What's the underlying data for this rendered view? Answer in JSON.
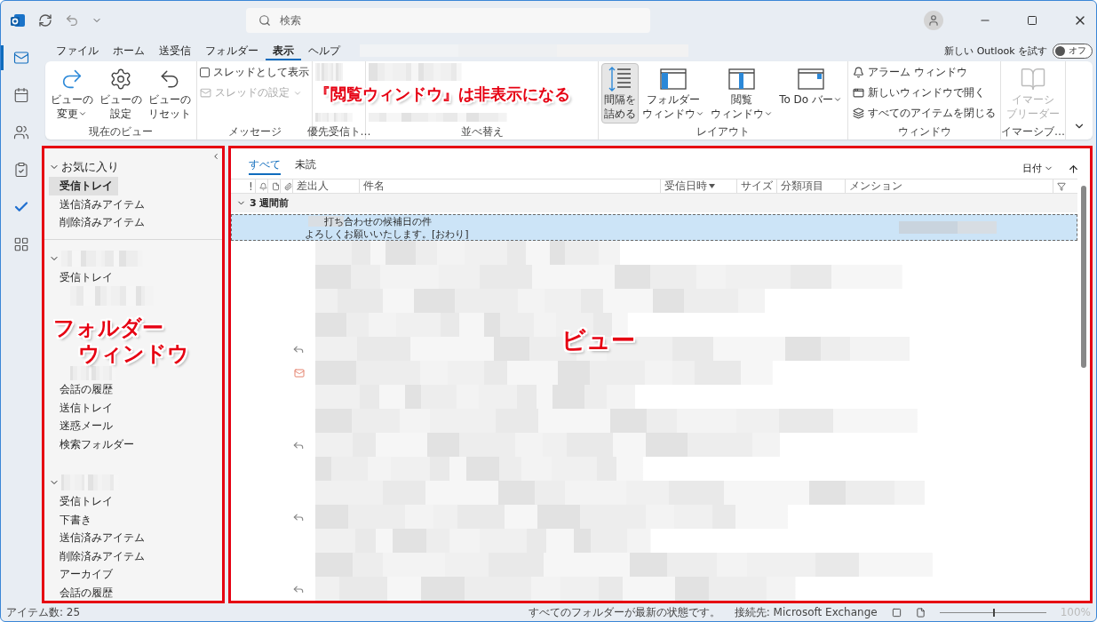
{
  "title_bar": {
    "search_placeholder": "検索"
  },
  "nav_rail": [
    {
      "kind": "mail",
      "selected": true
    },
    {
      "kind": "calendar",
      "selected": false
    },
    {
      "kind": "people",
      "selected": false
    },
    {
      "kind": "tasks",
      "selected": false
    },
    {
      "kind": "todo",
      "selected": false
    },
    {
      "kind": "apps",
      "selected": false
    }
  ],
  "menu_tabs": [
    {
      "label": "ファイル",
      "selected": false
    },
    {
      "label": "ホーム",
      "selected": false
    },
    {
      "label": "送受信",
      "selected": false
    },
    {
      "label": "フォルダー",
      "selected": false
    },
    {
      "label": "表示",
      "selected": true
    },
    {
      "label": "ヘルプ",
      "selected": false
    }
  ],
  "try_new_outlook": {
    "label": "新しい Outlook を試す",
    "toggle_label": "オフ",
    "on": false
  },
  "ribbon": {
    "callout": "『閲覧ウィンドウ』は非表示になる",
    "groups": [
      {
        "kind": "large",
        "label": "現在のビュー",
        "items": [
          {
            "kind": "change",
            "lines": [
              "ビューの",
              "変更"
            ],
            "caret": true,
            "selected": false,
            "disabled": false
          },
          {
            "kind": "settings",
            "lines": [
              "ビューの",
              "設定"
            ],
            "caret": false,
            "selected": false,
            "disabled": false
          },
          {
            "kind": "reset",
            "lines": [
              "ビューの",
              "リセット"
            ],
            "caret": false,
            "selected": false,
            "disabled": false
          }
        ]
      },
      {
        "kind": "message",
        "label": "メッセージ",
        "items": [
          {
            "kind": "checkbox",
            "label": "スレッドとして表示",
            "checked": false,
            "disabled": false
          },
          {
            "kind": "menu",
            "label": "スレッドの設定",
            "disabled": true
          }
        ]
      },
      {
        "kind": "redacted",
        "label": "優先受信ト…"
      },
      {
        "kind": "redacted",
        "label": "並べ替え"
      },
      {
        "kind": "large",
        "label": "レイアウト",
        "items": [
          {
            "kind": "spacing",
            "lines": [
              "間隔を",
              "詰める"
            ],
            "caret": false,
            "selected": true,
            "disabled": false
          },
          {
            "kind": "folder-pane",
            "lines": [
              "フォルダー",
              "ウィンドウ"
            ],
            "caret": true,
            "selected": false,
            "disabled": false
          },
          {
            "kind": "reading-pane",
            "lines": [
              "閲覧",
              "ウィンドウ"
            ],
            "caret": true,
            "selected": false,
            "disabled": false
          },
          {
            "kind": "todo-bar",
            "lines": [
              "To Do バー"
            ],
            "caret": true,
            "selected": false,
            "disabled": false
          }
        ]
      },
      {
        "kind": "small",
        "label": "ウィンドウ",
        "items": [
          {
            "kind": "bell",
            "label": "アラーム ウィンドウ"
          },
          {
            "kind": "new-window",
            "label": "新しいウィンドウで開く"
          },
          {
            "kind": "close-all",
            "label": "すべてのアイテムを閉じる"
          }
        ]
      },
      {
        "kind": "large",
        "label": "イマーシブ…",
        "items": [
          {
            "kind": "reader",
            "lines": [
              "イマーシ",
              "ブリーダー"
            ],
            "caret": false,
            "selected": false,
            "disabled": true
          }
        ]
      }
    ]
  },
  "folder_pane": {
    "callout": [
      "フォルダー",
      "ウィンドウ"
    ],
    "sections": [
      {
        "label": "お気に入り",
        "expanded": true,
        "divider": true,
        "items": [
          {
            "kind": "folder",
            "label": "受信トレイ",
            "selected": true
          },
          {
            "kind": "folder",
            "label": "送信済みアイテム",
            "selected": false
          },
          {
            "kind": "folder",
            "label": "削除済みアイテム",
            "selected": false
          }
        ]
      },
      {
        "expanded": true,
        "divider": false,
        "items": [
          {
            "kind": "folder",
            "label": "受信トレイ",
            "selected": false
          },
          {
            "kind": "redacted"
          },
          {
            "kind": "folder",
            "label": "会話の履歴",
            "selected": false
          },
          {
            "kind": "folder",
            "label": "送信トレイ",
            "selected": false
          },
          {
            "kind": "folder",
            "label": "迷惑メール",
            "selected": false
          },
          {
            "kind": "folder",
            "label": "検索フォルダー",
            "selected": false
          }
        ]
      },
      {
        "expanded": true,
        "divider": false,
        "items": [
          {
            "kind": "folder",
            "label": "受信トレイ",
            "selected": false
          },
          {
            "kind": "folder",
            "label": "下書き",
            "selected": false
          },
          {
            "kind": "folder",
            "label": "送信済みアイテム",
            "selected": false
          },
          {
            "kind": "folder",
            "label": "削除済みアイテム",
            "selected": false
          },
          {
            "kind": "folder",
            "label": "アーカイブ",
            "selected": false
          },
          {
            "kind": "folder",
            "label": "会話の履歴",
            "selected": false
          }
        ]
      }
    ]
  },
  "view": {
    "callout": "ビュー",
    "filter_tabs": [
      {
        "label": "すべて",
        "selected": true
      },
      {
        "label": "未読",
        "selected": false
      }
    ],
    "sort": {
      "label": "日付"
    },
    "columns": [
      {
        "kind": "importance",
        "label": "!"
      },
      {
        "kind": "reminder"
      },
      {
        "kind": "icon"
      },
      {
        "kind": "attachment"
      },
      {
        "kind": "text",
        "label": "差出人",
        "sorted": false
      },
      {
        "kind": "text",
        "label": "件名",
        "sorted": false
      },
      {
        "kind": "text",
        "label": "受信日時",
        "sorted": true
      },
      {
        "kind": "text",
        "label": "サイズ",
        "sorted": false
      },
      {
        "kind": "text",
        "label": "分類項目",
        "sorted": false
      },
      {
        "kind": "text",
        "label": "メンション",
        "sorted": false
      },
      {
        "kind": "filter"
      }
    ],
    "group": {
      "label": "3 週間前",
      "expanded": true
    },
    "selected_message": {
      "subject": "打ち合わせの候補日の件",
      "preview": "よろしくお願いいたします。[おわり]"
    },
    "rows": [
      {
        "kind": "plain"
      },
      {
        "kind": "plain"
      },
      {
        "kind": "plain"
      },
      {
        "kind": "plain"
      },
      {
        "kind": "reply"
      },
      {
        "kind": "envelope"
      },
      {
        "kind": "plain"
      },
      {
        "kind": "plain"
      },
      {
        "kind": "reply"
      },
      {
        "kind": "plain"
      },
      {
        "kind": "plain"
      },
      {
        "kind": "reply"
      },
      {
        "kind": "plain"
      },
      {
        "kind": "plain"
      },
      {
        "kind": "reply"
      }
    ]
  },
  "status_bar": {
    "item_count": "アイテム数: 25",
    "sync_status": "すべてのフォルダーが最新の状態です。",
    "connection": "接続先: Microsoft Exchange",
    "zoom": {
      "level": 0.5,
      "label": "100%"
    }
  }
}
